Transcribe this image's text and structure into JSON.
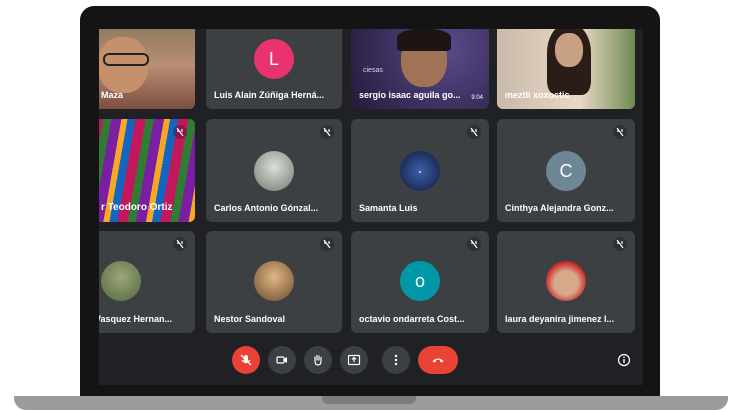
{
  "participants": [
    {
      "name": "Maza",
      "kind": "video",
      "muted": false
    },
    {
      "name": "Luis Alain Zúñiga Herná...",
      "kind": "initial",
      "initial": "L",
      "color": "#e8336f",
      "muted": false
    },
    {
      "name": "sergio isaac aguila go...",
      "kind": "video",
      "muted": false,
      "overlay_text": "ciesas",
      "time_text": "9:04"
    },
    {
      "name": "meztli xoxoctic",
      "kind": "video",
      "muted": false
    },
    {
      "name": "r Teodoro Ortiz",
      "kind": "video",
      "muted": true
    },
    {
      "name": "Carlos Antonio Gónzal...",
      "kind": "photo",
      "muted": true
    },
    {
      "name": "Samanta Luis",
      "kind": "logo",
      "muted": true
    },
    {
      "name": "Cinthya Alejandra Gonz...",
      "kind": "initial",
      "initial": "C",
      "color": "#6f8795",
      "muted": true
    },
    {
      "name": "Vasquez Hernan...",
      "kind": "photo",
      "muted": true
    },
    {
      "name": "Nestor Sandoval",
      "kind": "photo",
      "muted": true
    },
    {
      "name": "octavio ondarreta Cost...",
      "kind": "initial",
      "initial": "o",
      "color": "#0097a7",
      "muted": true
    },
    {
      "name": "laura deyanira jimenez l...",
      "kind": "photo",
      "muted": true
    }
  ],
  "controls": {
    "mic": "mic-off-icon",
    "camera": "camera-icon",
    "raise_hand": "hand-icon",
    "present": "present-screen-icon",
    "more": "more-options-icon",
    "leave": "end-call-icon",
    "info": "info-icon"
  },
  "colors": {
    "danger": "#ea4335",
    "tile": "#3c4043",
    "background": "#202124"
  }
}
